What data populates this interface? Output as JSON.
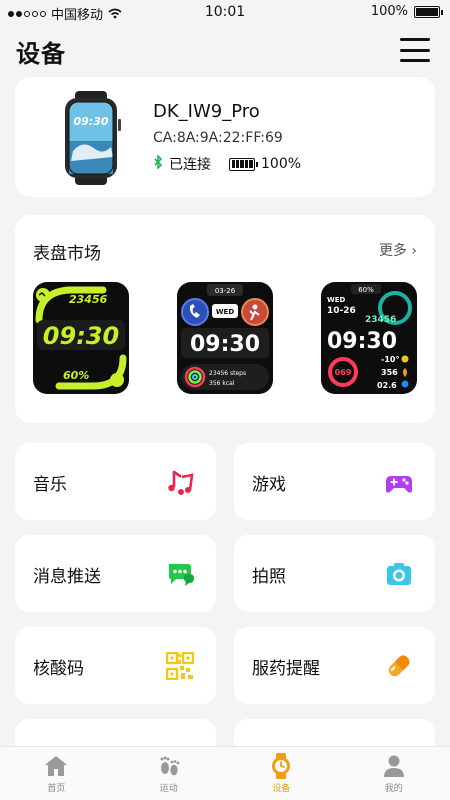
{
  "status_bar": {
    "carrier": "中国移动",
    "time": "10:01",
    "battery": "100%"
  },
  "header": {
    "title": "设备"
  },
  "device": {
    "name": "DK_IW9_Pro",
    "mac": "CA:8A:9A:22:FF:69",
    "status": "已连接",
    "battery": "100%",
    "watch_time": "09:30"
  },
  "market": {
    "title": "表盘市场",
    "more": "更多",
    "faces": [
      {
        "steps": "23456",
        "time": "09:30",
        "battery": "60%"
      },
      {
        "date": "03-26",
        "day": "WED",
        "time": "09:30",
        "steps": "23456 steps",
        "kcal": "356 kcal"
      },
      {
        "battery": "60%",
        "day": "WED",
        "date": "10-26",
        "steps": "23456",
        "time": "09:30",
        "hr": "069",
        "temp": "-10°",
        "kcal": "356",
        "dist": "02.6"
      }
    ]
  },
  "features": [
    {
      "label": "音乐",
      "icon": "music-icon"
    },
    {
      "label": "游戏",
      "icon": "gamepad-icon"
    },
    {
      "label": "消息推送",
      "icon": "message-icon"
    },
    {
      "label": "拍照",
      "icon": "camera-icon"
    },
    {
      "label": "核酸码",
      "icon": "qrcode-icon"
    },
    {
      "label": "服药提醒",
      "icon": "pill-icon"
    }
  ],
  "nav": [
    {
      "label": "首页",
      "icon": "home-icon"
    },
    {
      "label": "运动",
      "icon": "footprint-icon"
    },
    {
      "label": "设备",
      "icon": "watch-icon",
      "active": true
    },
    {
      "label": "我的",
      "icon": "user-icon"
    }
  ],
  "colors": {
    "accent": "#f39c12",
    "connected": "#1db954",
    "lime": "#c6f02a",
    "face_bg": "#0d0d0d"
  }
}
